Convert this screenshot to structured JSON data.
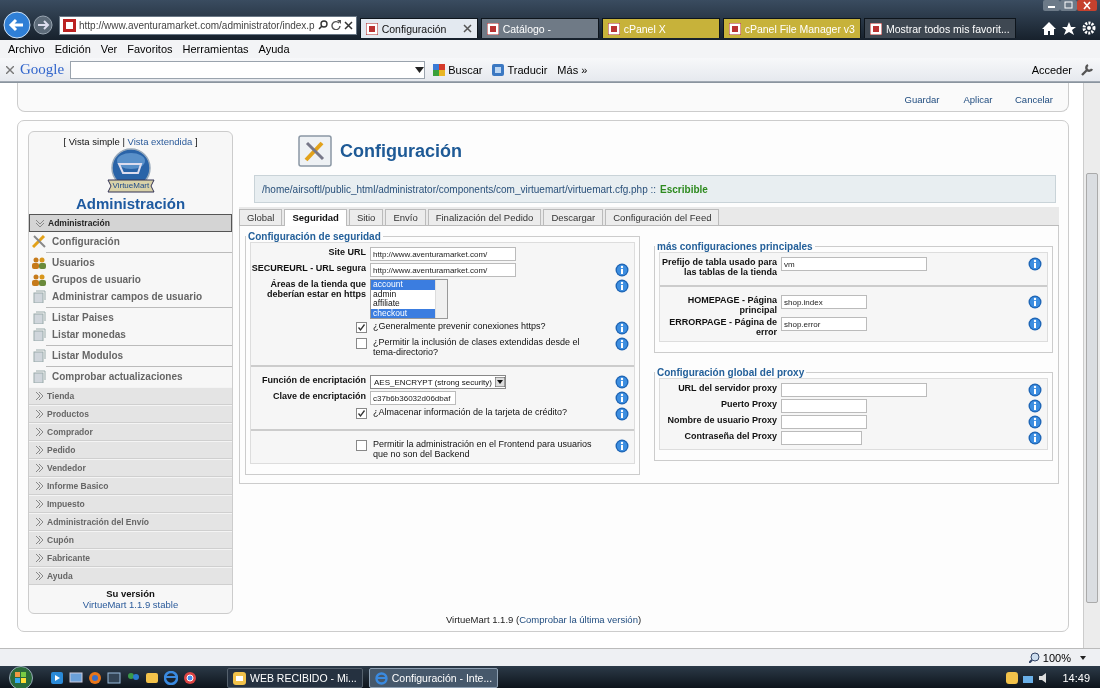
{
  "browser": {
    "address": "http://www.aventuramarket.com/administrator/index.p",
    "tabs": [
      {
        "label": "Configuración",
        "selected": true,
        "color": "#e3e9f0"
      },
      {
        "label": "Catálogo -",
        "selected": false,
        "color": "#6f7a86"
      },
      {
        "label": "cPanel X",
        "selected": false,
        "color": "#c7b23a"
      },
      {
        "label": "cPanel File Manager v3",
        "selected": false,
        "color": "#c7b23a"
      },
      {
        "label": "Mostrar todos mis favorit...",
        "selected": false,
        "color": "#3f4852"
      }
    ],
    "menu": [
      "Archivo",
      "Edición",
      "Ver",
      "Favoritos",
      "Herramientas",
      "Ayuda"
    ],
    "google_bar": {
      "logo": "Google",
      "buttons": [
        "Buscar",
        "Traducir",
        "Más »"
      ],
      "sign_in": "Acceder"
    }
  },
  "toolbar": [
    "Guardar",
    "Aplicar",
    "Cancelar"
  ],
  "sidebar": {
    "view_switch": [
      {
        "text": "[ Vista simple |",
        "kind": "text"
      },
      {
        "text": "Vista extendida",
        "kind": "link"
      },
      {
        "text": "]",
        "kind": "text"
      }
    ],
    "logo_badge": "VirtueMart",
    "title": "Administración",
    "sections": [
      {
        "label": "Administración",
        "expanded": true,
        "groups": [
          [
            {
              "label": "Configuración",
              "kind": "tools"
            }
          ],
          [
            {
              "label": "Usuarios",
              "kind": "users"
            },
            {
              "label": "Grupos de usuario",
              "kind": "users"
            },
            {
              "label": "Administrar campos de usuario",
              "kind": "page"
            }
          ],
          [
            {
              "label": "Listar Paises",
              "kind": "page"
            },
            {
              "label": "Listar monedas",
              "kind": "page"
            }
          ],
          [
            {
              "label": "Listar Modulos",
              "kind": "page"
            }
          ],
          [
            {
              "label": "Comprobar actualizaciones",
              "kind": "page"
            }
          ]
        ]
      },
      {
        "label": "Tienda",
        "expanded": false
      },
      {
        "label": "Productos",
        "expanded": false
      },
      {
        "label": "Comprador",
        "expanded": false
      },
      {
        "label": "Pedido",
        "expanded": false
      },
      {
        "label": "Vendedor",
        "expanded": false
      },
      {
        "label": "Informe Basico",
        "expanded": false
      },
      {
        "label": "Impuesto",
        "expanded": false
      },
      {
        "label": "Administración del Envío",
        "expanded": false
      },
      {
        "label": "Cupón",
        "expanded": false
      },
      {
        "label": "Fabricante",
        "expanded": false
      },
      {
        "label": "Ayuda",
        "expanded": false
      }
    ],
    "version": {
      "heading": "Su versión",
      "link": "VirtueMart 1.1.9 stable"
    }
  },
  "config": {
    "title": "Configuración",
    "path": "/home/airsoftl/public_html/administrator/components/com_virtuemart/virtuemart.cfg.php ::",
    "status": "Escribible",
    "tabs": [
      {
        "label": "Global",
        "selected": false
      },
      {
        "label": "Seguridad",
        "selected": true
      },
      {
        "label": "Sitio",
        "selected": false
      },
      {
        "label": "Envío",
        "selected": false
      },
      {
        "label": "Finalización del Pedido",
        "selected": false
      },
      {
        "label": "Descargar",
        "selected": false
      },
      {
        "label": "Configuración del Feed",
        "selected": false
      }
    ],
    "security": {
      "legend": "Configuración de seguridad",
      "sections": [
        [
          {
            "kind": "text",
            "label": "Site URL",
            "value": "http://www.aventuramarket.com/",
            "help": false
          },
          {
            "kind": "text",
            "label": "SECUREURL - URL segura",
            "value": "http://www.aventuramarket.com/",
            "help": true
          },
          {
            "kind": "listbox",
            "label": "Áreas de la tienda que deberían estar en https",
            "options": [
              {
                "label": "account",
                "selected": true
              },
              {
                "label": "admin",
                "selected": false
              },
              {
                "label": "affiliate",
                "selected": false
              },
              {
                "label": "checkout",
                "selected": true
              }
            ],
            "help": true
          },
          {
            "kind": "checkbox",
            "label": "¿Generalmente prevenir conexiones https?",
            "checked": true,
            "help": true
          },
          {
            "kind": "checkbox",
            "label": "¿Permitir la inclusión de clases extendidas desde el tema-directorio?",
            "checked": false,
            "help": true
          }
        ],
        [
          {
            "kind": "select",
            "label": "Función de encriptación",
            "value": "AES_ENCRYPT (strong security)",
            "help": true
          },
          {
            "kind": "text",
            "label": "Clave de encriptación",
            "value": "c37b6b36032d06dbaf",
            "help": true
          },
          {
            "kind": "checkbox",
            "label": "¿Almacenar información de la tarjeta de crédito?",
            "checked": true,
            "help": true
          }
        ],
        [
          {
            "kind": "checkbox",
            "label": "Permitir la administración en el Frontend para usuarios que no son del Backend",
            "checked": false,
            "help": true
          }
        ]
      ]
    },
    "main": {
      "legend": "más configuraciones principales",
      "sections": [
        [
          {
            "kind": "text",
            "label": "Prefijo de tabla usado para las tablas de la tienda",
            "value": "vm",
            "help": true
          }
        ],
        [
          {
            "kind": "text",
            "label": "HOMEPAGE - Página principal",
            "value": "shop.index",
            "help": true
          },
          {
            "kind": "text",
            "label": "ERRORPAGE - Página de error",
            "value": "shop.error",
            "help": true
          }
        ]
      ]
    },
    "proxy": {
      "legend": "Configuración global del proxy",
      "sections": [
        [
          {
            "kind": "text",
            "label": "URL del servidor proxy",
            "help": true
          },
          {
            "kind": "text",
            "label": "Puerto Proxy",
            "help": true
          },
          {
            "kind": "text",
            "label": "Nombre de usuario Proxy",
            "help": true
          },
          {
            "kind": "text",
            "label": "Contraseña del Proxy",
            "help": true
          }
        ]
      ]
    }
  },
  "footer": {
    "text": "VirtueMart 1.1.9 (",
    "link": "Comprobar la última versión",
    "suffix": ")"
  },
  "status_bar": {
    "zoom": "100%"
  },
  "taskbar": {
    "tasks": [
      {
        "label": "WEB RECIBIDO - Mi...",
        "selected": false,
        "kind": "mail"
      },
      {
        "label": "Configuración - Inte...",
        "selected": true,
        "kind": "globe"
      }
    ],
    "clock": "14:49"
  }
}
